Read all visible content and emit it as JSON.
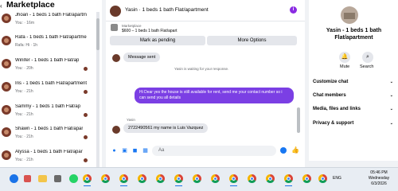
{
  "left": {
    "back_glyph": "‹",
    "title": "Marketplace",
    "conversations": [
      {
        "name": "Jhoan - 1 beds 1 bath Flat/apartm",
        "sub": "You: · 16m"
      },
      {
        "name": "Rafa - 1 beds 1 bath Flat/apartme",
        "sub": "Rafa: Hi · 1h"
      },
      {
        "name": "Winifer - 1 beds 1 bath Flat/ap",
        "sub": "You: · 20h"
      },
      {
        "name": "Iris - 1 beds 1 bath Flat/apartment",
        "sub": "You: · 21h"
      },
      {
        "name": "Sammy - 1 beds 1 bath Flat/ap",
        "sub": "You: · 21h"
      },
      {
        "name": "Shawn - 1 beds 1 bath Flat/apar",
        "sub": "You: · 21h"
      },
      {
        "name": "Alyssa - 1 beds 1 bath Flat/apar",
        "sub": "You: · 21h"
      }
    ]
  },
  "chat": {
    "title": "Yasin · 1 beds 1 bath Flat/apartment",
    "info_glyph": "i",
    "listing_source": "Marketplace",
    "listing_price": "$600 – 1 beds 1 bath Flat/apart",
    "mark_pending": "Mark as pending",
    "more_options": "More Options",
    "msg_sent": "Message sent",
    "waiting": "Yasin is waiting for your response.",
    "outgoing": "Hi Dear yes the house is still available for rent, send me your contact number so i can send you all details",
    "sender": "Yasin",
    "incoming": "2722490561 my name is Luis Vazquez",
    "input_placeholder": "Aa",
    "like_glyph": "👍"
  },
  "right": {
    "name": "Yasin - 1 beds 1 bath Flat/apartment",
    "mute": "Mute",
    "search": "Search",
    "sections": [
      "Customize chat",
      "Chat members",
      "Media, files and links",
      "Privacy & support"
    ]
  },
  "taskbar": {
    "time": "05:46 PM",
    "day": "Wednesday",
    "date": "6/3/2026",
    "tray": "ENG"
  }
}
